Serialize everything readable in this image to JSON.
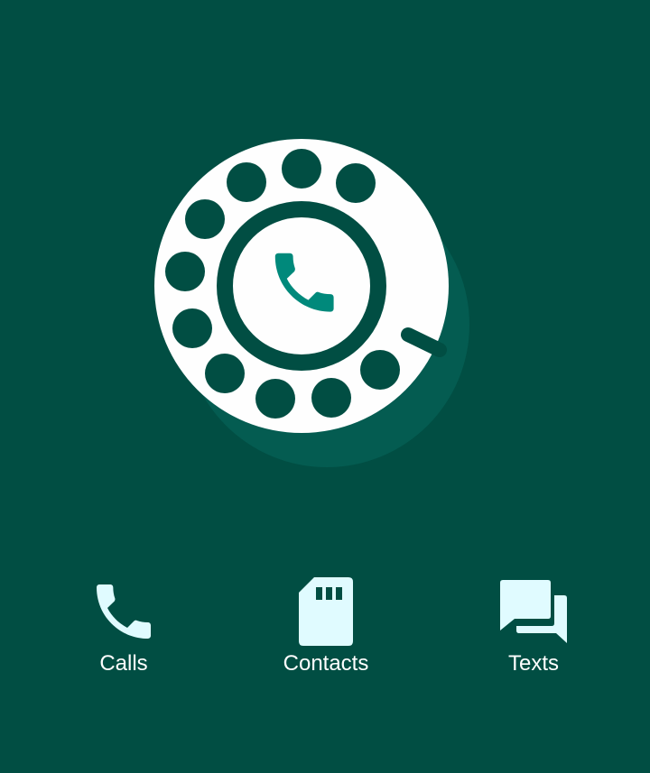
{
  "colors": {
    "background": "#014e43",
    "shadow": "#045c51",
    "dial": "#fefefe",
    "accent": "#00897b",
    "icon_fill": "#e0fbff",
    "label": "#ffffff"
  },
  "logo": {
    "icon": "rotary-dial-icon",
    "center_icon": "phone-icon"
  },
  "nav": {
    "items": [
      {
        "id": "calls",
        "label": "Calls",
        "icon": "phone-icon"
      },
      {
        "id": "contacts",
        "label": "Contacts",
        "icon": "sim-card-icon"
      },
      {
        "id": "texts",
        "label": "Texts",
        "icon": "chat-bubbles-icon"
      }
    ]
  }
}
